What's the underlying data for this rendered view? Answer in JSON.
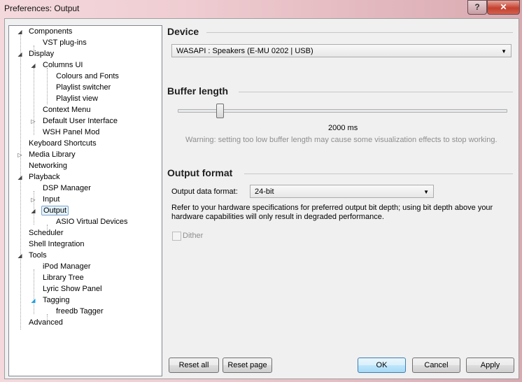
{
  "window": {
    "title": "Preferences: Output"
  },
  "titlebar": {
    "help_label": "?",
    "close_label": "✕"
  },
  "tree": {
    "items": [
      {
        "label": "Components"
      },
      {
        "label": "VST plug-ins"
      },
      {
        "label": "Display"
      },
      {
        "label": "Columns UI"
      },
      {
        "label": "Colours and Fonts"
      },
      {
        "label": "Playlist switcher"
      },
      {
        "label": "Playlist view"
      },
      {
        "label": "Context Menu"
      },
      {
        "label": "Default User Interface"
      },
      {
        "label": "WSH Panel Mod"
      },
      {
        "label": "Keyboard Shortcuts"
      },
      {
        "label": "Media Library"
      },
      {
        "label": "Networking"
      },
      {
        "label": "Playback"
      },
      {
        "label": "DSP Manager"
      },
      {
        "label": "Input"
      },
      {
        "label": "Output"
      },
      {
        "label": "ASIO Virtual Devices"
      },
      {
        "label": "Scheduler"
      },
      {
        "label": "Shell Integration"
      },
      {
        "label": "Tools"
      },
      {
        "label": "iPod Manager"
      },
      {
        "label": "Library Tree"
      },
      {
        "label": "Lyric Show Panel"
      },
      {
        "label": "Tagging"
      },
      {
        "label": "freedb Tagger"
      },
      {
        "label": "Advanced"
      }
    ],
    "selected": "Output"
  },
  "device": {
    "heading": "Device",
    "selected": "WASAPI : Speakers (E-MU 0202 | USB)"
  },
  "buffer": {
    "heading": "Buffer length",
    "value_label": "2000 ms",
    "warning": "Warning: setting too low buffer length may cause some visualization effects to stop working."
  },
  "output_format": {
    "heading": "Output format",
    "data_format_label": "Output data format:",
    "data_format_value": "24-bit",
    "note_line1": "Refer to your hardware specifications for preferred output bit depth; using bit depth above your",
    "note_line2": "hardware capabilities will only result in degraded performance.",
    "dither_label": "Dither"
  },
  "buttons": {
    "reset_all": "Reset all",
    "reset_page": "Reset page",
    "ok": "OK",
    "cancel": "Cancel",
    "apply": "Apply"
  }
}
